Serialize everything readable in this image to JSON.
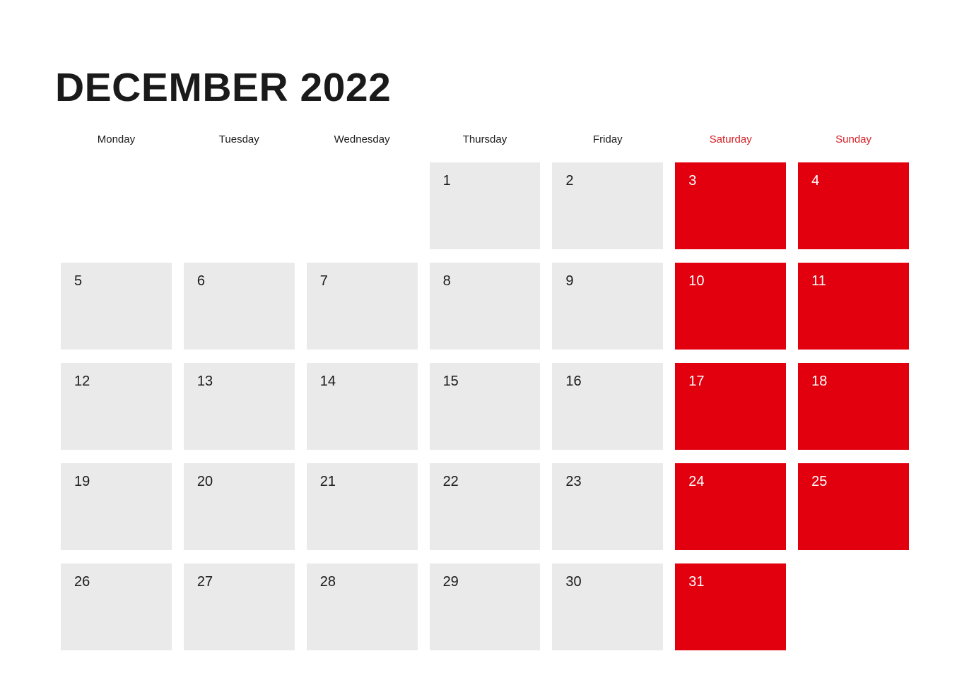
{
  "calendar": {
    "title": "DECEMBER 2022",
    "month": "December",
    "year": "2022",
    "colors": {
      "weekday_cell": "#eaeaea",
      "weekend_cell": "#e2000f",
      "weekend_header_text": "#d42026",
      "text": "#1a1a1a",
      "weekend_day_text": "#ffffff",
      "background": "#ffffff"
    },
    "weekdays": [
      {
        "label": "Monday",
        "weekend": false
      },
      {
        "label": "Tuesday",
        "weekend": false
      },
      {
        "label": "Wednesday",
        "weekend": false
      },
      {
        "label": "Thursday",
        "weekend": false
      },
      {
        "label": "Friday",
        "weekend": false
      },
      {
        "label": "Saturday",
        "weekend": true
      },
      {
        "label": "Sunday",
        "weekend": true
      }
    ],
    "weeks": [
      [
        {
          "day": "",
          "empty": true,
          "weekend": false
        },
        {
          "day": "",
          "empty": true,
          "weekend": false
        },
        {
          "day": "",
          "empty": true,
          "weekend": false
        },
        {
          "day": "1",
          "empty": false,
          "weekend": false
        },
        {
          "day": "2",
          "empty": false,
          "weekend": false
        },
        {
          "day": "3",
          "empty": false,
          "weekend": true
        },
        {
          "day": "4",
          "empty": false,
          "weekend": true
        }
      ],
      [
        {
          "day": "5",
          "empty": false,
          "weekend": false
        },
        {
          "day": "6",
          "empty": false,
          "weekend": false
        },
        {
          "day": "7",
          "empty": false,
          "weekend": false
        },
        {
          "day": "8",
          "empty": false,
          "weekend": false
        },
        {
          "day": "9",
          "empty": false,
          "weekend": false
        },
        {
          "day": "10",
          "empty": false,
          "weekend": true
        },
        {
          "day": "11",
          "empty": false,
          "weekend": true
        }
      ],
      [
        {
          "day": "12",
          "empty": false,
          "weekend": false
        },
        {
          "day": "13",
          "empty": false,
          "weekend": false
        },
        {
          "day": "14",
          "empty": false,
          "weekend": false
        },
        {
          "day": "15",
          "empty": false,
          "weekend": false
        },
        {
          "day": "16",
          "empty": false,
          "weekend": false
        },
        {
          "day": "17",
          "empty": false,
          "weekend": true
        },
        {
          "day": "18",
          "empty": false,
          "weekend": true
        }
      ],
      [
        {
          "day": "19",
          "empty": false,
          "weekend": false
        },
        {
          "day": "20",
          "empty": false,
          "weekend": false
        },
        {
          "day": "21",
          "empty": false,
          "weekend": false
        },
        {
          "day": "22",
          "empty": false,
          "weekend": false
        },
        {
          "day": "23",
          "empty": false,
          "weekend": false
        },
        {
          "day": "24",
          "empty": false,
          "weekend": true
        },
        {
          "day": "25",
          "empty": false,
          "weekend": true
        }
      ],
      [
        {
          "day": "26",
          "empty": false,
          "weekend": false
        },
        {
          "day": "27",
          "empty": false,
          "weekend": false
        },
        {
          "day": "28",
          "empty": false,
          "weekend": false
        },
        {
          "day": "29",
          "empty": false,
          "weekend": false
        },
        {
          "day": "30",
          "empty": false,
          "weekend": false
        },
        {
          "day": "31",
          "empty": false,
          "weekend": true
        },
        {
          "day": "",
          "empty": true,
          "weekend": true
        }
      ]
    ]
  }
}
